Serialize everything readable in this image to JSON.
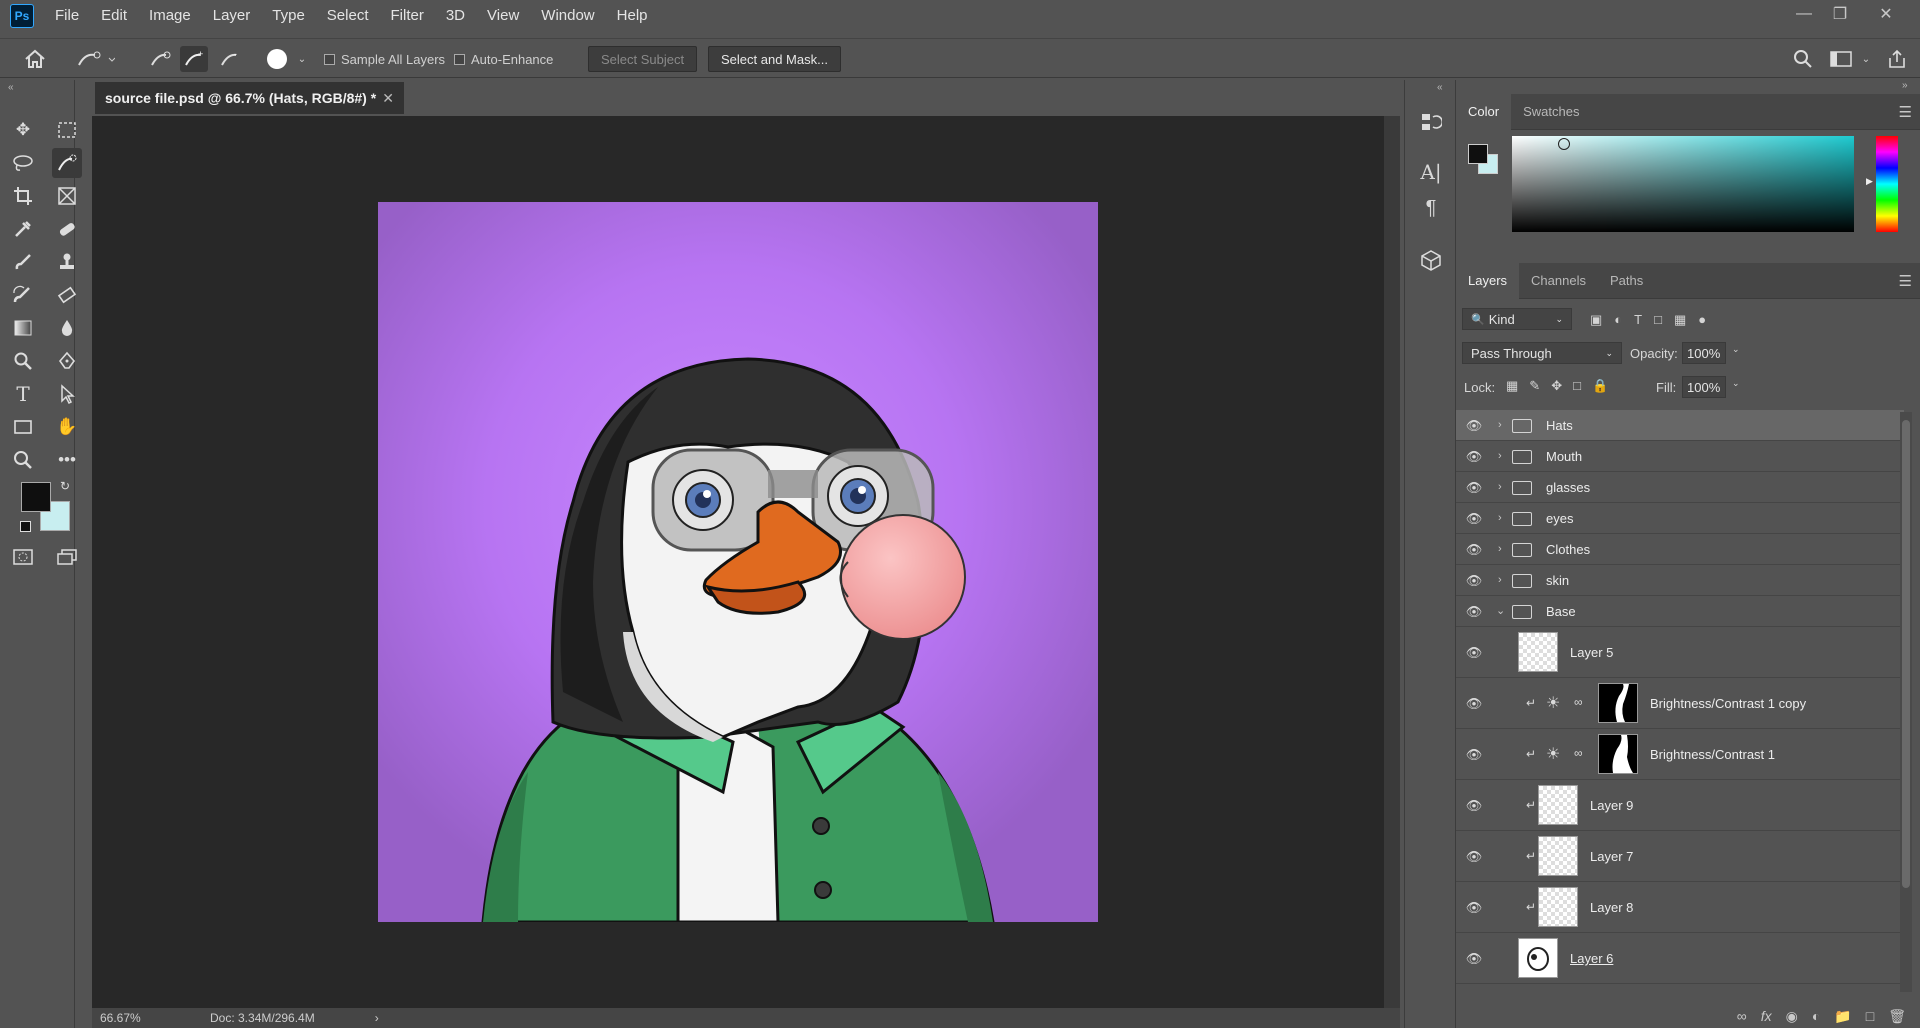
{
  "app": {
    "logo": "Ps",
    "menu": [
      "File",
      "Edit",
      "Image",
      "Layer",
      "Type",
      "Select",
      "Filter",
      "3D",
      "View",
      "Window",
      "Help"
    ]
  },
  "options": {
    "brush_size": "30",
    "sample_all_layers": "Sample All Layers",
    "auto_enhance": "Auto-Enhance",
    "select_subject": "Select Subject",
    "select_and_mask": "Select and Mask..."
  },
  "document": {
    "tab_title": "source file.psd @ 66.7% (Hats, RGB/8#) *",
    "zoom": "66.67%",
    "doc_info": "Doc: 3.34M/296.4M"
  },
  "colors": {
    "foreground": "#0f0f0f",
    "background": "#c8eef0",
    "canvas_bg": "#b673f0",
    "jacket": "#3b9a5e",
    "beak": "#e06a1f",
    "bubble": "#f3a3a3"
  },
  "color_panel": {
    "tabs": [
      "Color",
      "Swatches"
    ]
  },
  "layers_panel": {
    "tabs": [
      "Layers",
      "Channels",
      "Paths"
    ],
    "filter_kind": "Kind",
    "blend_mode": "Pass Through",
    "opacity_label": "Opacity:",
    "opacity": "100%",
    "lock_label": "Lock:",
    "fill_label": "Fill:",
    "fill": "100%",
    "groups": [
      {
        "name": "Hats"
      },
      {
        "name": "Mouth"
      },
      {
        "name": "glasses"
      },
      {
        "name": "eyes"
      },
      {
        "name": "Clothes"
      },
      {
        "name": "skin"
      },
      {
        "name": "Base"
      }
    ],
    "children": [
      {
        "name": "Layer 5"
      },
      {
        "name": "Brightness/Contrast 1 copy"
      },
      {
        "name": "Brightness/Contrast 1"
      },
      {
        "name": "Layer 9"
      },
      {
        "name": "Layer 7"
      },
      {
        "name": "Layer 8"
      },
      {
        "name": "Layer 6"
      }
    ]
  },
  "icons": {
    "home": "home-icon",
    "search": "search-icon",
    "share": "share-icon"
  }
}
